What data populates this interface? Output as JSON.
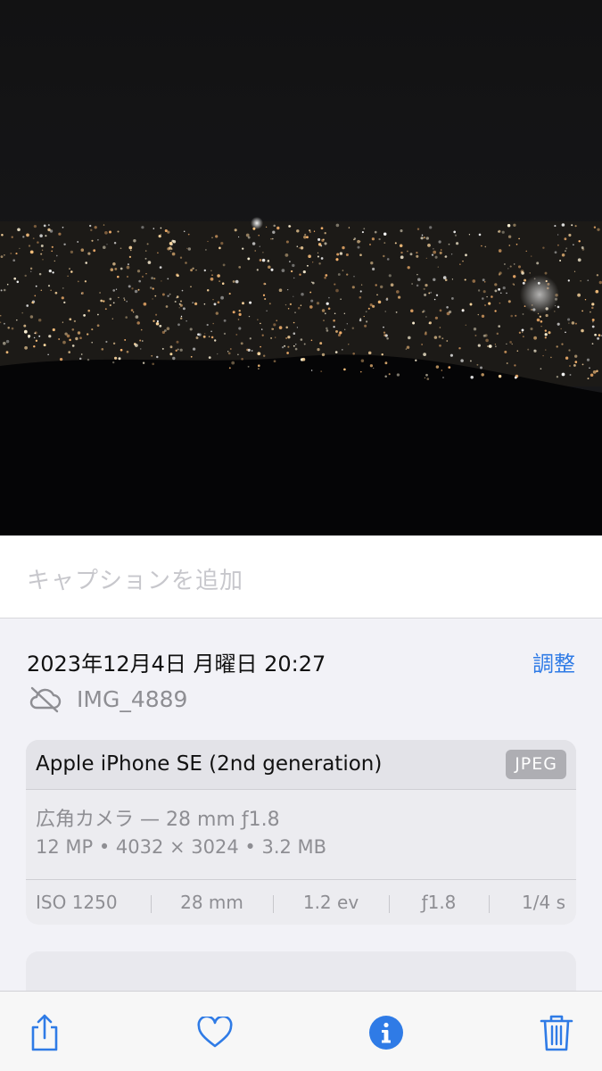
{
  "photo": {
    "subject": "night-cityscape"
  },
  "caption": {
    "placeholder": "キャプションを追加"
  },
  "info": {
    "datetime": "2023年12月4日 月曜日 20:27",
    "adjust_label": "調整",
    "file_name": "IMG_4889",
    "cloud_icon": "cloud-off-icon"
  },
  "metadata": {
    "device": "Apple iPhone SE (2nd generation)",
    "format_badge": "JPEG",
    "lens": "広角カメラ — 28 mm ƒ1.8",
    "specs": "12 MP • 4032 × 3024 • 3.2 MB",
    "exif": {
      "iso": "ISO 1250",
      "focal": "28 mm",
      "ev": "1.2 ev",
      "aperture": "ƒ1.8",
      "shutter": "1/4 s"
    }
  },
  "toolbar": {
    "items": [
      "share-icon",
      "heart-icon",
      "info-icon",
      "trash-icon"
    ]
  },
  "colors": {
    "accent": "#2f7be6",
    "secondary_text": "#8e8e93",
    "background": "#f2f2f7"
  }
}
